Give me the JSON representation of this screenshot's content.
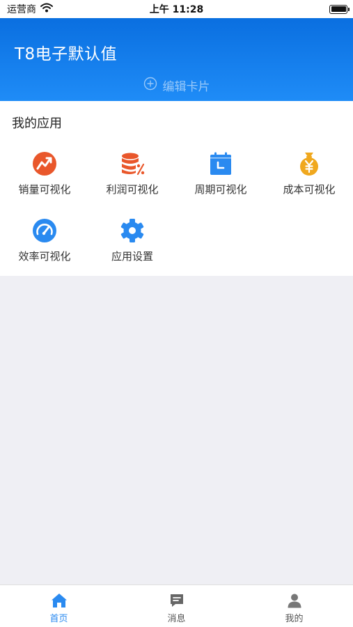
{
  "status_bar": {
    "carrier": "运营商",
    "time": "上午 11:28"
  },
  "header": {
    "title": "T8电子默认值",
    "edit_label": "编辑卡片",
    "color": "#0a6fe0"
  },
  "apps": {
    "section_title": "我的应用",
    "items": [
      {
        "label": "销量可视化",
        "icon": "trend-icon",
        "color": "#e9572b"
      },
      {
        "label": "利润可视化",
        "icon": "coins-percent-icon",
        "color": "#e9572b"
      },
      {
        "label": "周期可视化",
        "icon": "calendar-icon",
        "color": "#2a8af0"
      },
      {
        "label": "成本可视化",
        "icon": "money-bag-icon",
        "color": "#f0a81e"
      },
      {
        "label": "效率可视化",
        "icon": "gauge-icon",
        "color": "#2a8af0"
      },
      {
        "label": "应用设置",
        "icon": "gear-icon",
        "color": "#2a8af0"
      }
    ]
  },
  "tabbar": {
    "active_color": "#2a8af0",
    "inactive_color": "#555555",
    "tabs": [
      {
        "label": "首页",
        "icon": "home-icon",
        "active": true
      },
      {
        "label": "消息",
        "icon": "message-icon",
        "active": false
      },
      {
        "label": "我的",
        "icon": "user-icon",
        "active": false
      }
    ]
  }
}
